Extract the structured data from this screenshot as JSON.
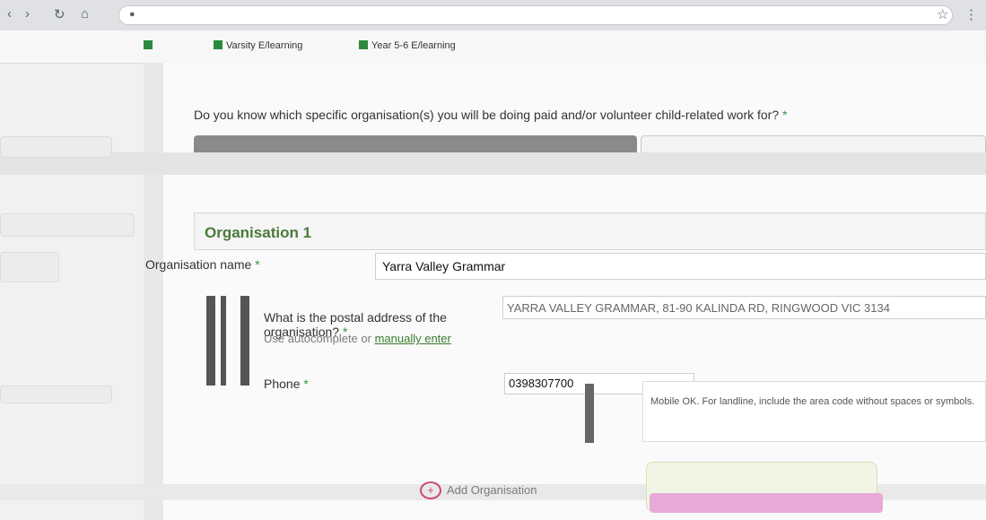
{
  "browser": {
    "url": "",
    "bookmarks": [
      "",
      "Varsity E/learning",
      "Year 5-6 E/learning"
    ]
  },
  "form": {
    "question": "Do you know which specific organisation(s) you will be doing paid and/or volunteer child-related work for?",
    "required_mark": "*",
    "options": {
      "yes": "",
      "no": ""
    },
    "organisation": {
      "title": "Organisation 1",
      "name_label": "Organisation name",
      "name_value": "Yarra Valley Grammar",
      "address_label": "What is the postal address of the organisation?",
      "address_help": "Use autocomplete or",
      "address_link": "manually enter",
      "address_value": "YARRA VALLEY GRAMMAR, 81-90 KALINDA RD, RINGWOOD VIC 3134",
      "phone_label": "Phone",
      "phone_value": "0398307700",
      "phone_help": "Mobile OK. For landline, include the area code without spaces or symbols."
    },
    "add_label": "Add Organisation"
  },
  "colors": {
    "accent": "#2e9a4a",
    "add": "#cc4a70",
    "selected": "#8a8a8a"
  }
}
